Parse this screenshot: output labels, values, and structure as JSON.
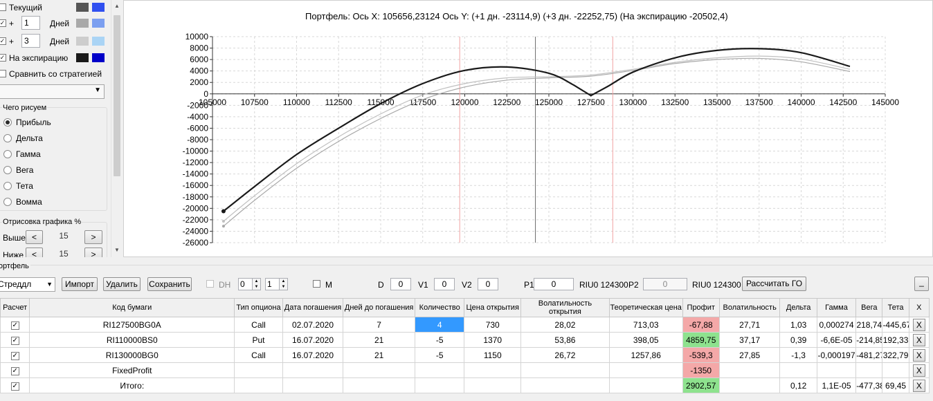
{
  "left_panel": {
    "row_current_label": "Текущий",
    "row_plus1_prefix": "+",
    "row_plus1_days": "1",
    "row_plus1_suffix": "Дней",
    "row_plus3_prefix": "+",
    "row_plus3_days": "3",
    "row_plus3_suffix": "Дней",
    "row_expiry_label": "На экспирацию",
    "compare_label": "Сравнить со стратегией",
    "what_to_draw_title": "Чего рисуем",
    "options": [
      "Прибыль",
      "Дельта",
      "Гамма",
      "Вега",
      "Тета",
      "Вомма"
    ],
    "selected_option": "Прибыль",
    "render_title": "Отрисовка графика %",
    "above_label": "Выше",
    "above_value": "15",
    "below_label": "Ниже",
    "below_value": "15",
    "colors": {
      "current_dark": "#555555",
      "current_light": "#3050f0",
      "p1_dark": "#a9a9a9",
      "p1_light": "#7b9ff0",
      "p3_dark": "#cdcdcd",
      "p3_light": "#aad4f5",
      "exp_dark": "#1a1a1a",
      "exp_light": "#0000c8"
    }
  },
  "chart": {
    "title": "Портфель: Ось X:  105656,23124  Ось Y:  (+1 дн.  -23114,9)  (+3 дн.  -22252,75)  (На экспирацию  -20502,4)"
  },
  "chart_data": {
    "type": "line",
    "xlim": [
      105000,
      145000
    ],
    "ylim": [
      -26000,
      10000
    ],
    "x_ticks": [
      "105000",
      "107500",
      "110000",
      "112500",
      "115000",
      "117500",
      "120000",
      "122500",
      "125000",
      "127500",
      "130000",
      "132500",
      "135000",
      "137500",
      "140000",
      "142500",
      "145000"
    ],
    "y_ticks": [
      "10000",
      "8000",
      "6000",
      "4000",
      "2000",
      "0",
      "-2000",
      "-4000",
      "-6000",
      "-8000",
      "-10000",
      "-12000",
      "-14000",
      "-16000",
      "-18000",
      "-20000",
      "-22000",
      "-24000",
      "-26000"
    ],
    "vertical_lines": {
      "current_price": 124200,
      "red_markers": [
        119700,
        128800
      ]
    },
    "series": [
      {
        "color": "#1a1a1a",
        "x": [
          105656,
          107500,
          110000,
          112500,
          115000,
          117500,
          120000,
          122500,
          125000,
          126500,
          127500,
          128500,
          130000,
          132500,
          135000,
          137500,
          140000,
          142900
        ],
        "y": [
          -20502,
          -16200,
          -10600,
          -6000,
          -1700,
          1800,
          4100,
          4700,
          3600,
          1500,
          -300,
          1300,
          3800,
          6300,
          7600,
          7900,
          7200,
          4800
        ]
      },
      {
        "color": "#c0c0c0",
        "x": [
          105656,
          107500,
          110000,
          112500,
          115000,
          117500,
          120000,
          122500,
          125000,
          127500,
          130000,
          132500,
          135000,
          137500,
          140000,
          142900
        ],
        "y": [
          -22252,
          -17800,
          -12200,
          -7500,
          -3500,
          -200,
          1800,
          2800,
          3000,
          3300,
          4300,
          5500,
          6300,
          6600,
          6100,
          4300
        ]
      },
      {
        "color": "#a8a8a8",
        "x": [
          105656,
          107500,
          110000,
          112500,
          115000,
          117500,
          120000,
          122500,
          125000,
          127500,
          130000,
          132500,
          135000,
          137500,
          140000,
          142900
        ],
        "y": [
          -23114,
          -18600,
          -13000,
          -8300,
          -4300,
          -1000,
          1200,
          2400,
          2800,
          3100,
          4100,
          5300,
          6000,
          6200,
          5600,
          3900
        ]
      }
    ]
  },
  "portfolio": {
    "title": "Портфель",
    "strategy_select": "Стреддл",
    "import_label": "Импорт",
    "delete_label": "Удалить",
    "save_label": "Сохранить",
    "dh_label": "DH",
    "dh_value1": "0",
    "dh_value2": "1",
    "m_label": "M",
    "d_label": "D",
    "d_value": "0",
    "v1_label": "V1",
    "v1_value": "0",
    "v2_label": "V2",
    "v2_value": "0",
    "p1_label": "P1",
    "p1_value": "0",
    "p1_ticker": "RIU0 124300",
    "p2_label": "P2",
    "p2_value": "0",
    "p2_ticker": "RIU0 124300",
    "calc_go_label": "Рассчитать ГО",
    "minimize_label": "_"
  },
  "table": {
    "headers": [
      "Расчет",
      "Код бумаги",
      "Тип опциона",
      "Дата погашения",
      "Дней до погашения",
      "Количество",
      "Цена открытия",
      "Волатильность открытия",
      "Теоретическая цена",
      "Профит",
      "Волатильность",
      "Дельта",
      "Гамма",
      "Вега",
      "Тета",
      "X"
    ],
    "rows": [
      {
        "code": "RI127500BG0A",
        "type": "Call",
        "date": "02.07.2020",
        "days": "7",
        "qty": "4",
        "price": "730",
        "vol_open": "28,02",
        "theo": "713,03",
        "profit": "-67,88",
        "vol": "27,71",
        "delta": "1,03",
        "gamma": "0,000274",
        "vega": "218,74",
        "theta": "-445,67",
        "x": "X"
      },
      {
        "code": "RI110000BS0",
        "type": "Put",
        "date": "16.07.2020",
        "days": "21",
        "qty": "-5",
        "price": "1370",
        "vol_open": "53,86",
        "theo": "398,05",
        "profit": "4859,75",
        "vol": "37,17",
        "delta": "0,39",
        "gamma": "-6,6E-05",
        "vega": "-214,85",
        "theta": "192,33",
        "x": "X"
      },
      {
        "code": "RI130000BG0",
        "type": "Call",
        "date": "16.07.2020",
        "days": "21",
        "qty": "-5",
        "price": "1150",
        "vol_open": "26,72",
        "theo": "1257,86",
        "profit": "-539,3",
        "vol": "27,85",
        "delta": "-1,3",
        "gamma": "-0,000197",
        "vega": "-481,27",
        "theta": "322,79",
        "x": "X"
      },
      {
        "code": "FixedProfit",
        "type": "",
        "date": "",
        "days": "",
        "qty": "",
        "price": "",
        "vol_open": "",
        "theo": "",
        "profit": "-1350",
        "vol": "",
        "delta": "",
        "gamma": "",
        "vega": "",
        "theta": "",
        "x": "X"
      },
      {
        "code": "Итого:",
        "type": "",
        "date": "",
        "days": "",
        "qty": "",
        "price": "",
        "vol_open": "",
        "theo": "",
        "profit": "2902,57",
        "vol": "",
        "delta": "0,12",
        "gamma": "1,1E-05",
        "vega": "-477,38",
        "theta": "69,45",
        "x": "X"
      }
    ]
  }
}
